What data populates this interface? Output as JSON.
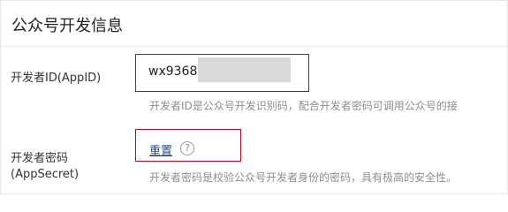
{
  "section": {
    "title": "公众号开发信息"
  },
  "appid_row": {
    "label": "开发者ID(AppID)",
    "value": "wx9368e",
    "hint": "开发者ID是公众号开发识别码，配合开发者密码可调用公众号的接"
  },
  "secret_row": {
    "label_line1": "开发者密码",
    "label_line2": "(AppSecret)",
    "reset_label": "重置",
    "help_glyph": "?",
    "hint": "开发者密码是校验公众号开发者身份的密码，具有极高的安全性。"
  },
  "colors": {
    "highlight_border": "#d0021b",
    "link": "#2c4a8a",
    "hint_text": "#8d8d8d",
    "redaction": "#d9d9d9"
  },
  "icons": {
    "help": "question-circle-icon"
  }
}
